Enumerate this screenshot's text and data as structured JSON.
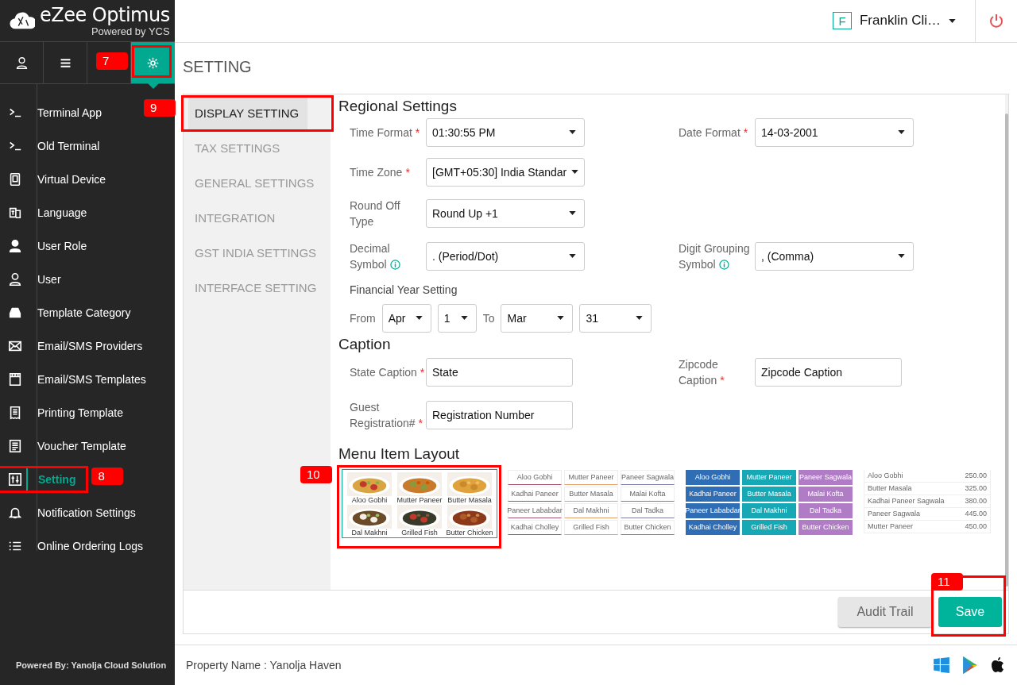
{
  "brand": {
    "name": "eZee Optimus",
    "tagline": "Powered by YCS"
  },
  "toolbar": [
    {
      "selected": false
    },
    {
      "selected": false
    },
    {
      "selected": true,
      "callout": "7"
    }
  ],
  "sidebar": {
    "items": [
      {
        "label": "Terminal App",
        "selected": false
      },
      {
        "label": "Old Terminal",
        "selected": false
      },
      {
        "label": "Virtual Device",
        "selected": false
      },
      {
        "label": "Language",
        "selected": false
      },
      {
        "label": "User Role",
        "selected": false
      },
      {
        "label": "User",
        "selected": false
      },
      {
        "label": "Template Category",
        "selected": false
      },
      {
        "label": "Email/SMS Providers",
        "selected": false
      },
      {
        "label": "Email/SMS Templates",
        "selected": false
      },
      {
        "label": "Printing Template",
        "selected": false
      },
      {
        "label": "Voucher Template",
        "selected": false
      },
      {
        "label": "Setting",
        "selected": true,
        "callout": "8"
      },
      {
        "label": "Notification Settings",
        "selected": false
      },
      {
        "label": "Online Ordering Logs",
        "selected": false
      }
    ],
    "footer": "Powered By: Yanolja Cloud Solution"
  },
  "header": {
    "avatar": "F",
    "user": "Franklin Cli…"
  },
  "page_title": "SETTING",
  "tabs": [
    {
      "label": "DISPLAY SETTING",
      "selected": true,
      "callout": "9"
    },
    {
      "label": "TAX SETTINGS",
      "selected": false
    },
    {
      "label": "GENERAL SETTINGS",
      "selected": false
    },
    {
      "label": "INTEGRATION",
      "selected": false
    },
    {
      "label": "GST INDIA SETTINGS",
      "selected": false
    },
    {
      "label": "INTERFACE SETTING",
      "selected": false
    }
  ],
  "regional": {
    "title": "Regional Settings",
    "rows": [
      [
        {
          "label": "Time Format",
          "required_mark": "*",
          "value": "01:30:55 PM"
        },
        {
          "label": "Date Format",
          "required_mark": "*",
          "value": "14-03-2001"
        }
      ],
      [
        {
          "label": "Time Zone",
          "required_mark": "*",
          "value": "[GMT+05:30] India Standar"
        }
      ],
      [
        {
          "label": "Round Off Type",
          "value": "Round Up +1"
        }
      ],
      [
        {
          "label": "Decimal Symbol",
          "info": true,
          "value": ". (Period/Dot)"
        },
        {
          "label": "Digit Grouping Symbol",
          "info": true,
          "value": ", (Comma)"
        }
      ]
    ],
    "financial_year": {
      "title": "Financial Year Setting",
      "from_label": "From",
      "from_month": "Apr",
      "from_day": "1",
      "to_label": "To",
      "to_month": "Mar",
      "to_day": "31"
    }
  },
  "caption": {
    "title": "Caption",
    "rows": [
      [
        {
          "label": "State Caption",
          "required_mark": "*",
          "value": "State"
        },
        {
          "label": "Zipcode Caption",
          "required_mark": "*",
          "value": "Zipcode Caption"
        }
      ],
      [
        {
          "label": "Guest Registration#",
          "required_mark": "*",
          "value": "Registration Number"
        }
      ]
    ]
  },
  "menu_layout": {
    "title": "Menu Item Layout",
    "layouts": [
      {
        "kind": "picture",
        "selected": true,
        "callout": "10",
        "items": [
          {
            "label": "Aloo Gobhi"
          },
          {
            "label": "Mutter Paneer"
          },
          {
            "label": "Butter Masala"
          },
          {
            "label": "Dal Makhni"
          },
          {
            "label": "Grilled Fish"
          },
          {
            "label": "Butter Chicken"
          }
        ]
      },
      {
        "kind": "outline",
        "selected": false,
        "items": [
          {
            "label": "Aloo Gobhi",
            "color": "#a3506e"
          },
          {
            "label": "Mutter Paneer",
            "color": "#e2a06c"
          },
          {
            "label": "Paneer Sagwala",
            "color": "#7c7ca6"
          },
          {
            "label": "Kadhai Paneer",
            "color": "#a3506e"
          },
          {
            "label": "Butter Masala",
            "color": "#e2a06c"
          },
          {
            "label": "Malai Kofta",
            "color": "#7c7ca6"
          },
          {
            "label": "Paneer Lababdar",
            "color": "#a3506e"
          },
          {
            "label": "Dal Makhni",
            "color": "#e2a06c"
          },
          {
            "label": "Dal Tadka",
            "color": "#7c7ca6"
          },
          {
            "label": "Kadhai Cholley",
            "color": "#a3506e"
          },
          {
            "label": "Grilled Fish",
            "color": "#e2a06c"
          },
          {
            "label": "Butter Chicken",
            "color": "#7c7ca6"
          }
        ]
      },
      {
        "kind": "tiles",
        "selected": false,
        "items": [
          {
            "label": "Aloo Gobhi",
            "color": "#2f6db5"
          },
          {
            "label": "Mutter Paneer",
            "color": "#17a8b5"
          },
          {
            "label": "Paneer Sagwala",
            "color": "#b07cc6"
          },
          {
            "label": "Kadhai Paneer",
            "color": "#2f6db5"
          },
          {
            "label": "Butter Masala",
            "color": "#17a8b5"
          },
          {
            "label": "Malai Kofta",
            "color": "#b07cc6"
          },
          {
            "label": "Paneer Lababdar",
            "color": "#2f6db5"
          },
          {
            "label": "Dal Makhni",
            "color": "#17a8b5"
          },
          {
            "label": "Dal Tadka",
            "color": "#b07cc6"
          },
          {
            "label": "Kadhai Cholley",
            "color": "#2f6db5"
          },
          {
            "label": "Grilled Fish",
            "color": "#17a8b5"
          },
          {
            "label": "Butter Chicken",
            "color": "#b07cc6"
          }
        ]
      },
      {
        "kind": "list",
        "selected": false,
        "items": [
          {
            "label": "Aloo Gobhi",
            "price": "250.00"
          },
          {
            "label": "Butter Masala",
            "price": "325.00"
          },
          {
            "label": "Kadhai Paneer Sagwala",
            "price": "380.00"
          },
          {
            "label": "Paneer Sagwala",
            "price": "445.00"
          },
          {
            "label": "Mutter Paneer",
            "price": "450.00"
          }
        ]
      }
    ]
  },
  "actions": [
    {
      "kind": "secondary",
      "label": "Audit Trail"
    },
    {
      "kind": "primary",
      "label": "Save",
      "callout": "11"
    }
  ],
  "status_bar": {
    "property": "Property Name : Yanolja Haven"
  }
}
